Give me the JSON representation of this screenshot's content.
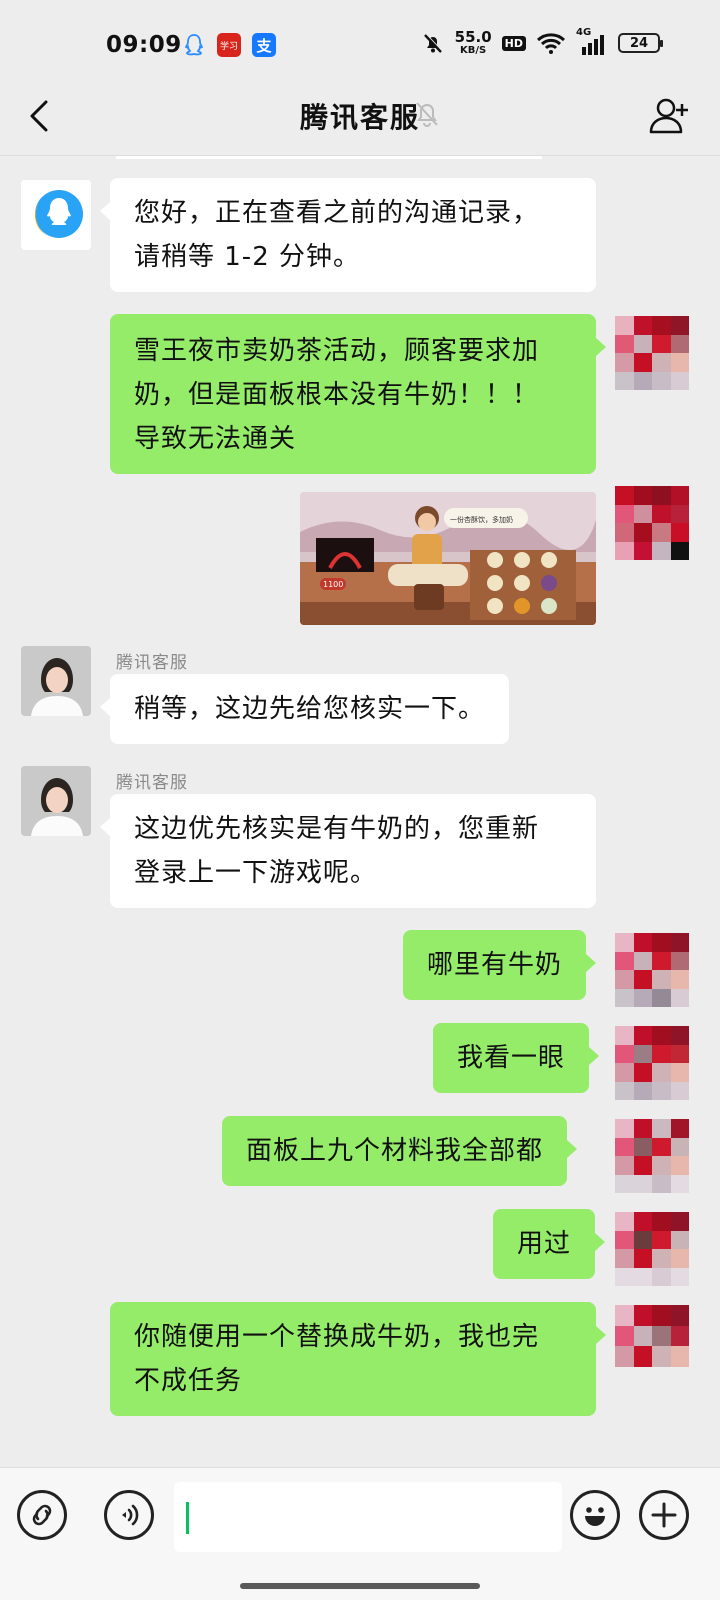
{
  "status_bar": {
    "time": "09:09",
    "app_icon_label": "学习",
    "pay_icon_label": "支",
    "net_speed_value": "55.0",
    "net_speed_unit": "KB/S",
    "hd": "HD",
    "network": "4G",
    "battery": "24"
  },
  "header": {
    "title": "腾讯客服",
    "back_icon": "chevron-left-icon",
    "mute_icon": "bell-muted-icon",
    "add_icon": "add-user-icon"
  },
  "messages": [
    {
      "from": "agent",
      "sender": "",
      "text_line1": "您好，正在查看之前的沟通记录，",
      "text_line2": "请稍等 1-2 分钟。"
    },
    {
      "from": "me",
      "text_line1": "雪王夜市卖奶茶活动，顾客要求加",
      "text_line2": "奶，但是面板根本没有牛奶！！！",
      "text_line3": "导致无法通关"
    },
    {
      "from": "me",
      "type": "image",
      "caption": "一份杏酥饮，多加奶",
      "score": "1100"
    },
    {
      "from": "agent",
      "sender": "腾讯客服",
      "text": "稍等，这边先给您核实一下。"
    },
    {
      "from": "agent",
      "sender": "腾讯客服",
      "text_line1": "这边优先核实是有牛奶的，您重新",
      "text_line2": "登录上一下游戏呢。"
    },
    {
      "from": "me",
      "text": "哪里有牛奶"
    },
    {
      "from": "me",
      "text": "我看一眼"
    },
    {
      "from": "me",
      "text": "面板上九个材料我全部都"
    },
    {
      "from": "me",
      "text": "用过"
    },
    {
      "from": "me",
      "text_line1": "你随便用一个替换成牛奶，我也完",
      "text_line2": "不成任务"
    }
  ],
  "input_bar": {
    "mini_program_icon": "link-icon",
    "voice_icon": "voice-icon",
    "emoji_icon": "emoji-icon",
    "add_icon": "plus-icon"
  },
  "colors": {
    "background": "#ededed",
    "outgoing_bubble": "#95ec69",
    "incoming_bubble": "#ffffff"
  }
}
